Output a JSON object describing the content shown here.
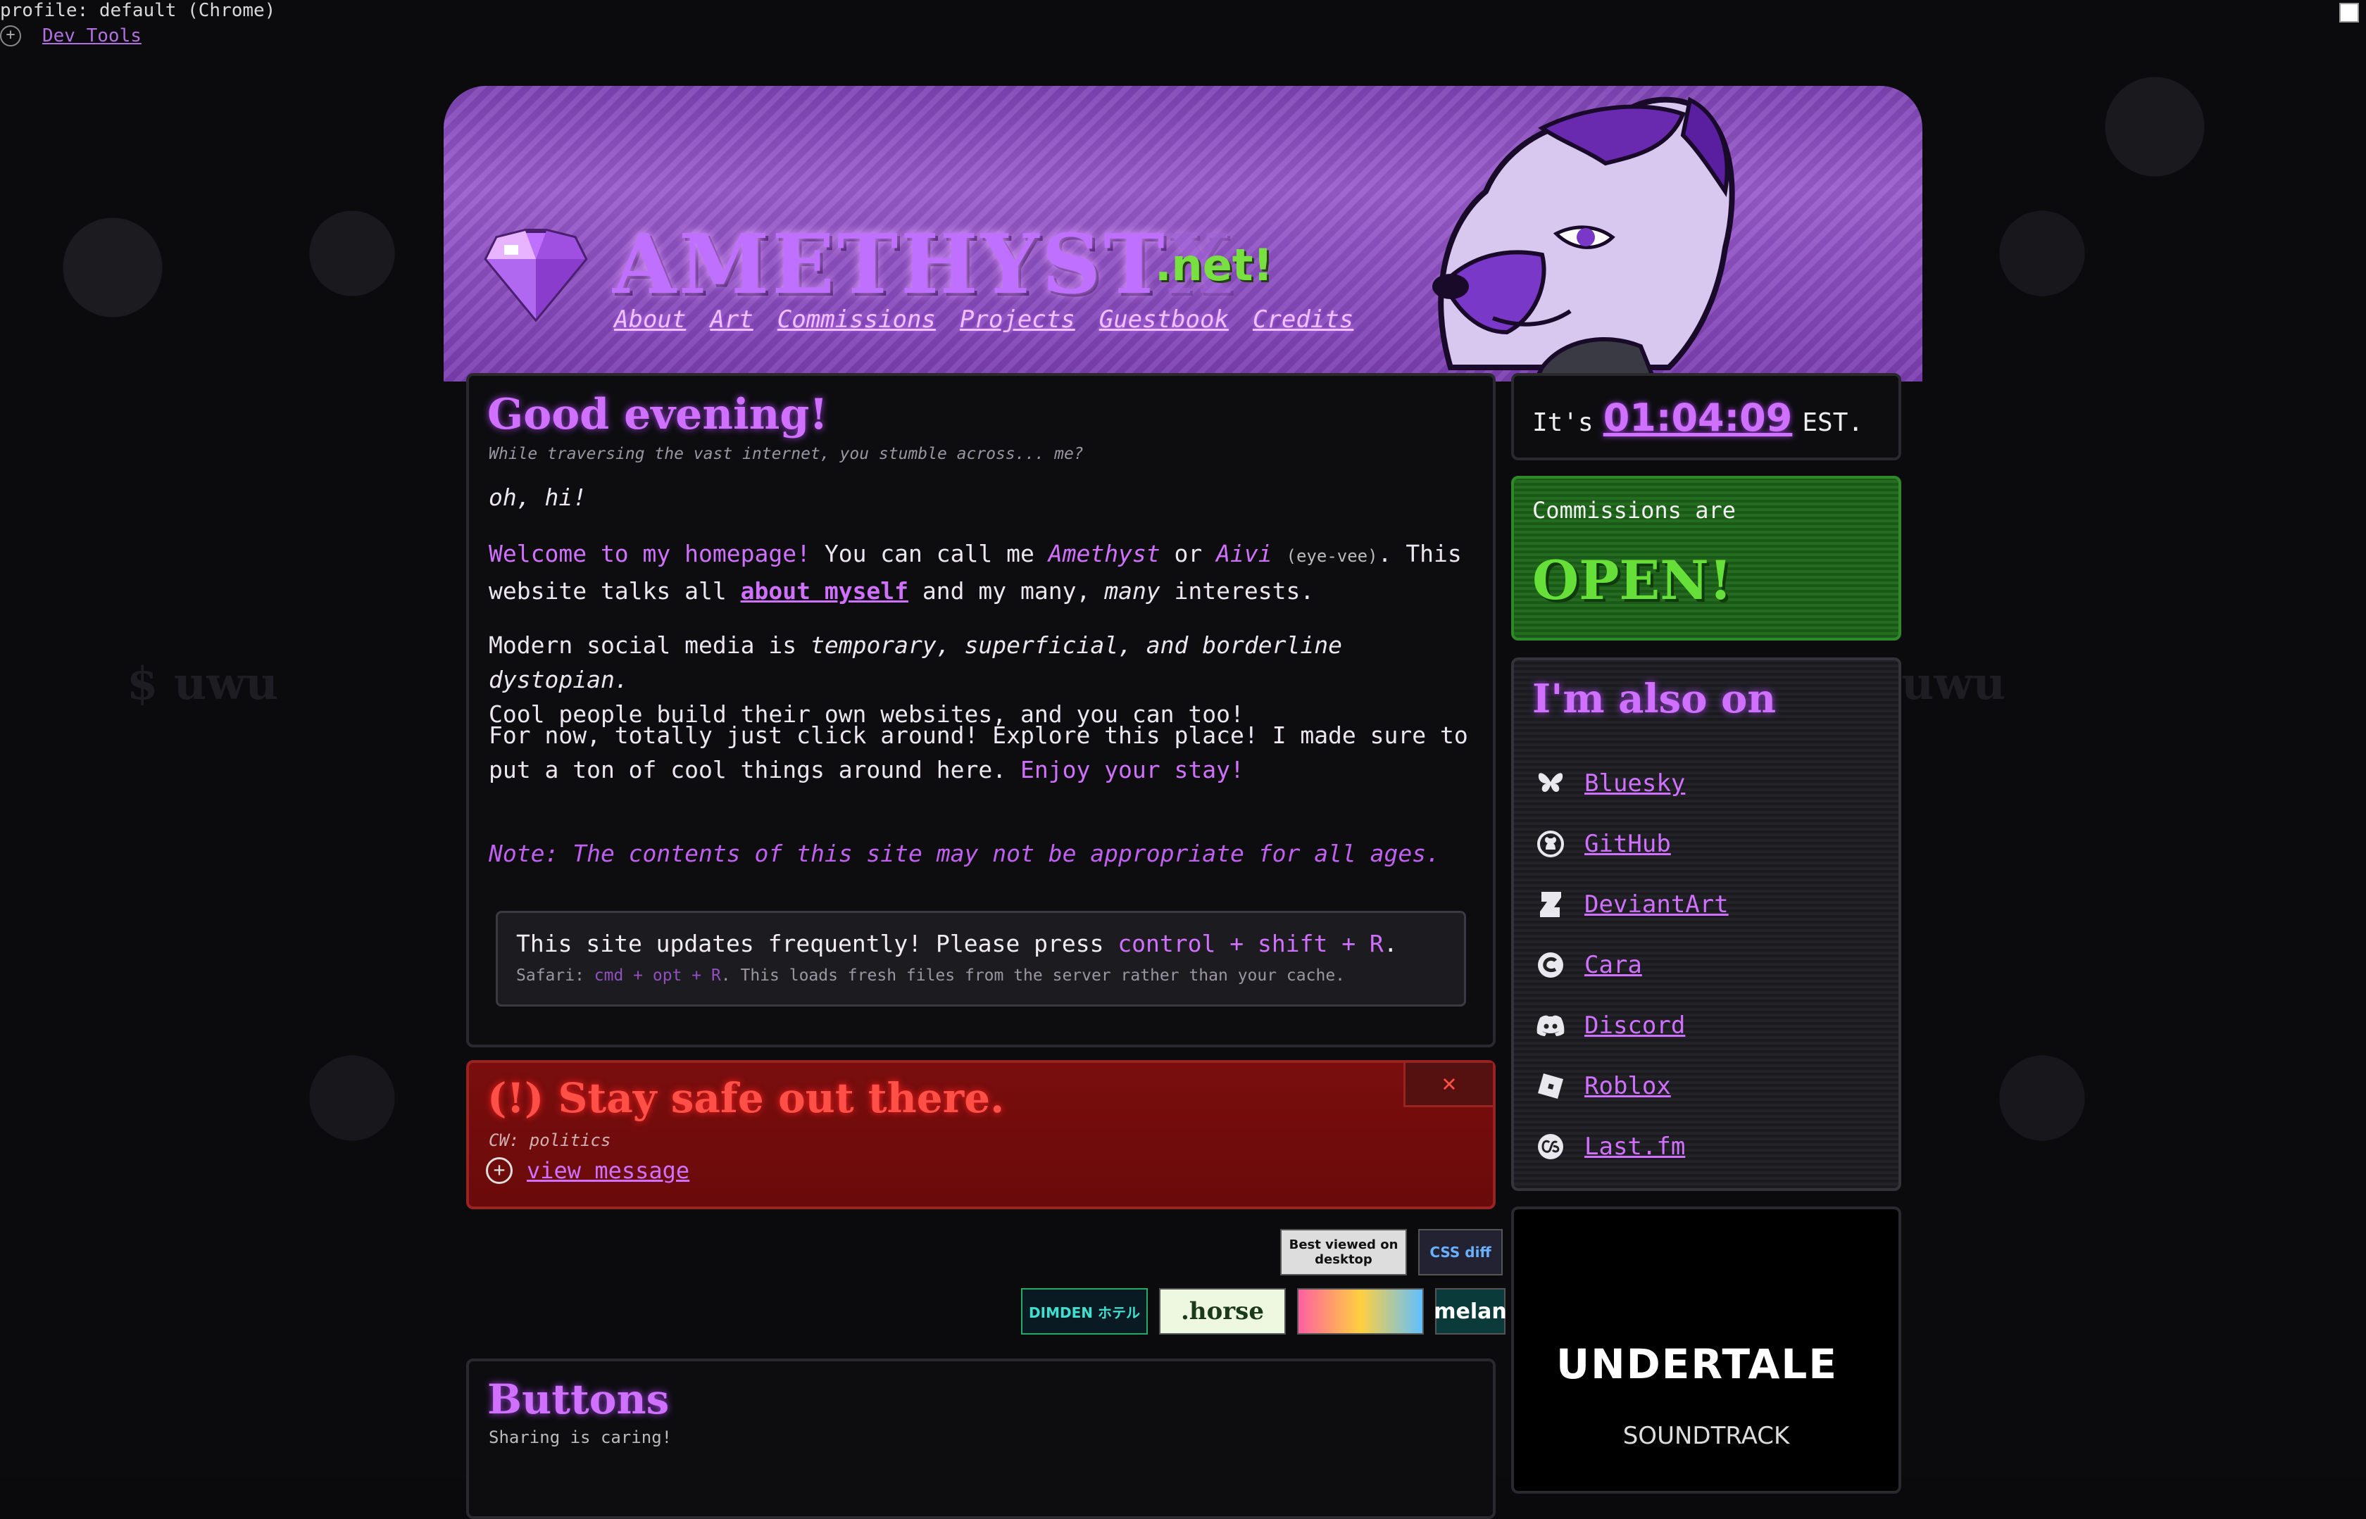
{
  "topbar": {
    "profile": "profile: default (Chrome)",
    "devtools": "Dev Tools"
  },
  "background": {
    "text_left": "$ uwu",
    "text_right": "uwu"
  },
  "header": {
    "title_bright": "AMETHYST",
    "title_dim": "X",
    "tld": ".net!",
    "nav": [
      "About",
      "Art",
      "Commissions",
      "Projects",
      "Guestbook",
      "Credits"
    ]
  },
  "main": {
    "greeting": "Good evening!",
    "subtitle": "While traversing the vast internet, you stumble across... me?",
    "intro": "oh, hi!",
    "welcome": "Welcome to my homepage!",
    "call_me": " You can call me ",
    "name1": "Amethyst",
    "or": " or ",
    "name2": "Aivi",
    "pronounce": "(eye-vee)",
    "talks": ". This website talks all ",
    "about_link": "about myself",
    "and_many": " and my many, ",
    "many": "many",
    "interests": " interests.",
    "social_1": "Modern social media is ",
    "social_em": "temporary, superficial, and borderline dystopian.",
    "social_2": "Cool people build their own websites, and you can too!",
    "explore": "For now, totally just click around! Explore this place! I made sure to put a ton of cool things around here. ",
    "enjoy": "Enjoy your stay!",
    "note": "Note: The contents of this site may not be appropriate for all ages.",
    "update_text": "This site updates frequently! Please press ",
    "update_keys": "control + shift + R",
    "update_end": ".",
    "safari_label": "Safari: ",
    "safari_keys": "cmd + opt + R",
    "safari_rest": ". This loads fresh files from the server rather than your cache."
  },
  "warning": {
    "title": "(!) Stay safe out there.",
    "cw": "CW: politics",
    "view": "view message",
    "close": "✕"
  },
  "badges": {
    "row1": [
      "Best viewed on desktop",
      "CSS diff"
    ],
    "row2": [
      "DIMDEN ホテル",
      ".horse",
      "",
      "melan"
    ]
  },
  "buttons": {
    "title": "Buttons",
    "subtitle": "Sharing is caring!"
  },
  "clock": {
    "prefix": "It's",
    "time": "01:04:09",
    "zone": "EST."
  },
  "commissions": {
    "label": "Commissions are",
    "status": "OPEN!"
  },
  "social": {
    "title": "I'm also on",
    "items": [
      {
        "label": "Bluesky",
        "icon": "butterfly-icon"
      },
      {
        "label": "GitHub",
        "icon": "github-icon"
      },
      {
        "label": "DeviantArt",
        "icon": "deviantart-icon"
      },
      {
        "label": "Cara",
        "icon": "cara-icon"
      },
      {
        "label": "Discord",
        "icon": "discord-icon"
      },
      {
        "label": "Roblox",
        "icon": "roblox-icon"
      },
      {
        "label": "Last.fm",
        "icon": "lastfm-icon"
      }
    ]
  },
  "undertale": {
    "title": "UNDERTALE",
    "subtitle": "SOUNDTRACK"
  },
  "colors": {
    "accent": "#d070ff",
    "green": "#66e038",
    "warn": "#ff5048"
  }
}
